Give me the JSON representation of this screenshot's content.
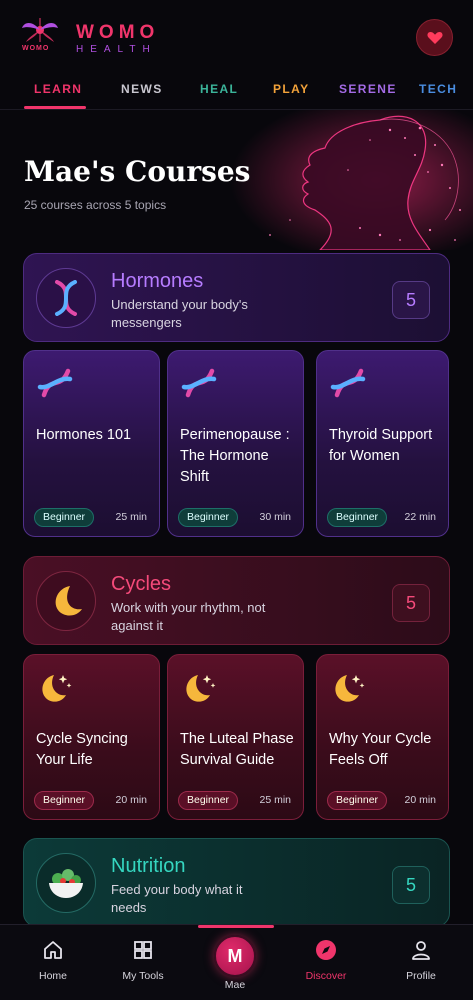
{
  "brand": {
    "name_top": "WOMO",
    "name_bottom": "HEALTH",
    "mark_text": "WOMO"
  },
  "tabs": [
    {
      "label": "LEARN",
      "color": "#f0356b",
      "active": true
    },
    {
      "label": "NEWS",
      "color": "#c9c7d0"
    },
    {
      "label": "HEAL",
      "color": "#3bb49a"
    },
    {
      "label": "PLAY",
      "color": "#f2a23a"
    },
    {
      "label": "SERENE",
      "color": "#a46be6"
    },
    {
      "label": "TECH",
      "color": "#4a8de0"
    }
  ],
  "hero": {
    "title": "Mae's Courses",
    "subtitle": "25 courses across 5 topics"
  },
  "topics": [
    {
      "name": "Hormones",
      "description": "Understand your body's messengers",
      "count": "5",
      "icon": "dna-icon",
      "courses": [
        {
          "title": "Hormones 101",
          "level": "Beginner",
          "duration": "25 min"
        },
        {
          "title": "Perimenopause : The Hormone Shift",
          "level": "Beginner",
          "duration": "30 min"
        },
        {
          "title": "Thyroid Support for Women",
          "level": "Beginner",
          "duration": "22 min"
        }
      ]
    },
    {
      "name": "Cycles",
      "description": "Work with your rhythm, not against it",
      "count": "5",
      "icon": "moon-icon",
      "courses": [
        {
          "title": "Cycle Syncing Your Life",
          "level": "Beginner",
          "duration": "20 min"
        },
        {
          "title": "The Luteal Phase Survival Guide",
          "level": "Beginner",
          "duration": "25 min"
        },
        {
          "title": "Why Your Cycle Feels Off",
          "level": "Beginner",
          "duration": "20 min"
        }
      ]
    },
    {
      "name": "Nutrition",
      "description": "Feed your body what it needs",
      "count": "5",
      "icon": "salad-bowl-icon"
    }
  ],
  "bottom_nav": {
    "home": "Home",
    "tools": "My Tools",
    "avatar_initial": "M",
    "avatar_label": "Mae",
    "discover": "Discover",
    "profile": "Profile"
  },
  "colors": {
    "accent": "#f0356b",
    "hormones": "#b67cff",
    "cycles": "#f54a7a",
    "nutrition": "#35d6c0"
  }
}
